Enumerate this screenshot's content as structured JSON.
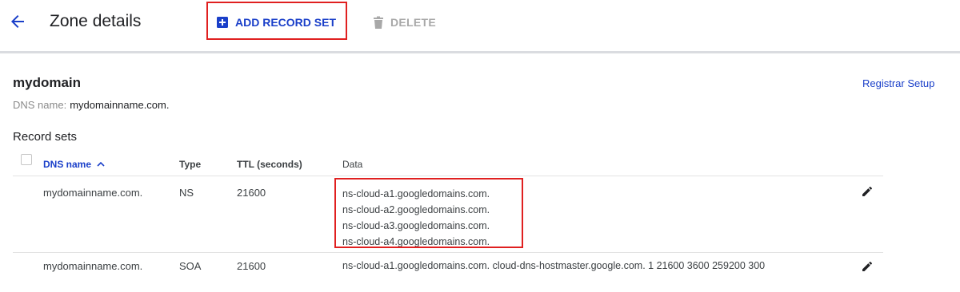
{
  "header": {
    "title": "Zone details",
    "add_record_label": "ADD RECORD SET",
    "delete_label": "DELETE"
  },
  "zone": {
    "name": "mydomain",
    "dns_label": "DNS name:",
    "dns_value": "mydomainname.com.",
    "registrar_link": "Registrar Setup"
  },
  "record_sets": {
    "title": "Record sets",
    "columns": [
      "DNS name",
      "Type",
      "TTL (seconds)",
      "Data"
    ],
    "sort_indicator": "^",
    "rows": [
      {
        "dns_name": "mydomainname.com.",
        "type": "NS",
        "ttl": "21600",
        "data": [
          "ns-cloud-a1.googledomains.com.",
          "ns-cloud-a2.googledomains.com.",
          "ns-cloud-a3.googledomains.com.",
          "ns-cloud-a4.googledomains.com."
        ]
      },
      {
        "dns_name": "mydomainname.com.",
        "type": "SOA",
        "ttl": "21600",
        "data": [
          "ns-cloud-a1.googledomains.com. cloud-dns-hostmaster.google.com. 1 21600 3600 259200 300"
        ]
      }
    ]
  },
  "icons": {
    "back": "arrow-back-icon",
    "add": "add-box-icon",
    "delete": "trash-icon",
    "edit": "pencil-icon"
  },
  "colors": {
    "accent": "#1a3fc9",
    "highlight_box": "#e02020",
    "disabled": "#a8a8a8"
  }
}
